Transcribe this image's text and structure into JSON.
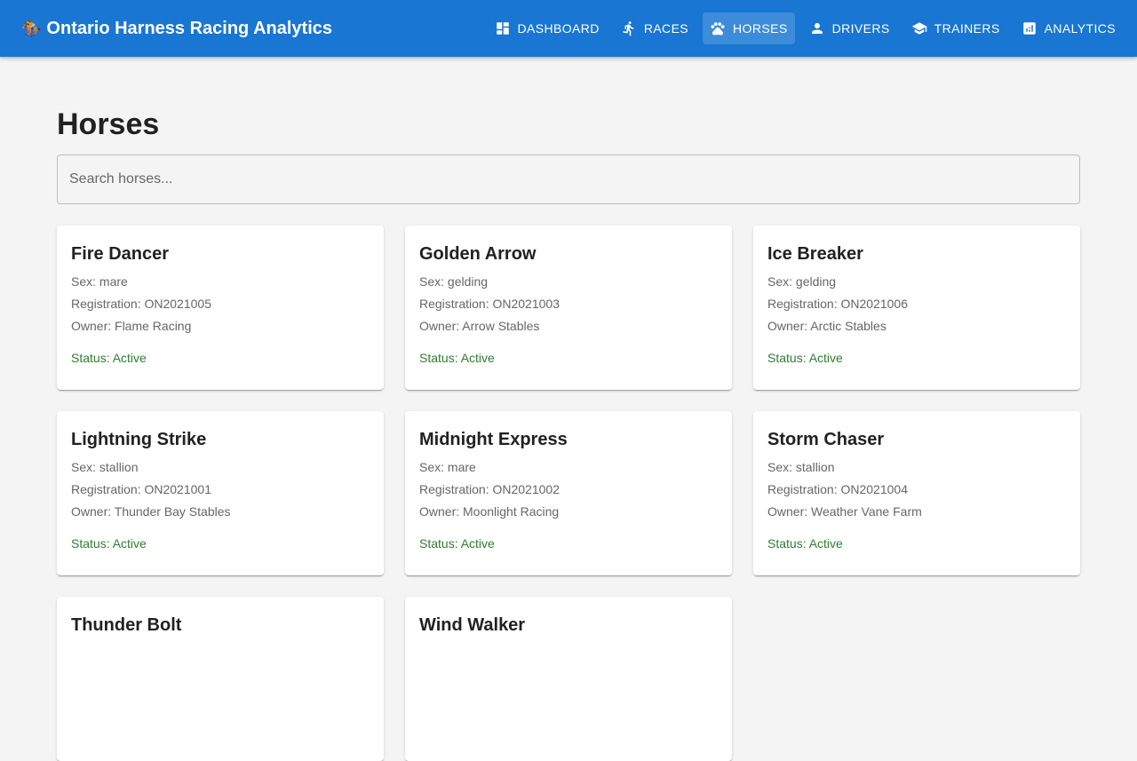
{
  "app": {
    "brand_icon": "🏇",
    "title": "Ontario Harness Racing Analytics"
  },
  "nav": {
    "items": [
      {
        "label": "DASHBOARD",
        "icon": "dashboard-icon"
      },
      {
        "label": "RACES",
        "icon": "run-icon"
      },
      {
        "label": "HORSES",
        "icon": "paw-icon",
        "active": true
      },
      {
        "label": "DRIVERS",
        "icon": "person-icon"
      },
      {
        "label": "TRAINERS",
        "icon": "school-icon"
      },
      {
        "label": "ANALYTICS",
        "icon": "analytics-icon"
      }
    ]
  },
  "page": {
    "title": "Horses",
    "search_placeholder": "Search horses...",
    "search_value": ""
  },
  "horses": [
    {
      "name": "Fire Dancer",
      "sex": "Sex: mare",
      "registration": "Registration: ON2021005",
      "owner": "Owner: Flame Racing",
      "status": "Status: Active"
    },
    {
      "name": "Golden Arrow",
      "sex": "Sex: gelding",
      "registration": "Registration: ON2021003",
      "owner": "Owner: Arrow Stables",
      "status": "Status: Active"
    },
    {
      "name": "Ice Breaker",
      "sex": "Sex: gelding",
      "registration": "Registration: ON2021006",
      "owner": "Owner: Arctic Stables",
      "status": "Status: Active"
    },
    {
      "name": "Lightning Strike",
      "sex": "Sex: stallion",
      "registration": "Registration: ON2021001",
      "owner": "Owner: Thunder Bay Stables",
      "status": "Status: Active"
    },
    {
      "name": "Midnight Express",
      "sex": "Sex: mare",
      "registration": "Registration: ON2021002",
      "owner": "Owner: Moonlight Racing",
      "status": "Status: Active"
    },
    {
      "name": "Storm Chaser",
      "sex": "Sex: stallion",
      "registration": "Registration: ON2021004",
      "owner": "Owner: Weather Vane Farm",
      "status": "Status: Active"
    },
    {
      "name": "Thunder Bolt"
    },
    {
      "name": "Wind Walker"
    }
  ],
  "colors": {
    "appbar": "#1976d2",
    "status_active": "#2e7d32",
    "background": "#f4f4f4"
  }
}
